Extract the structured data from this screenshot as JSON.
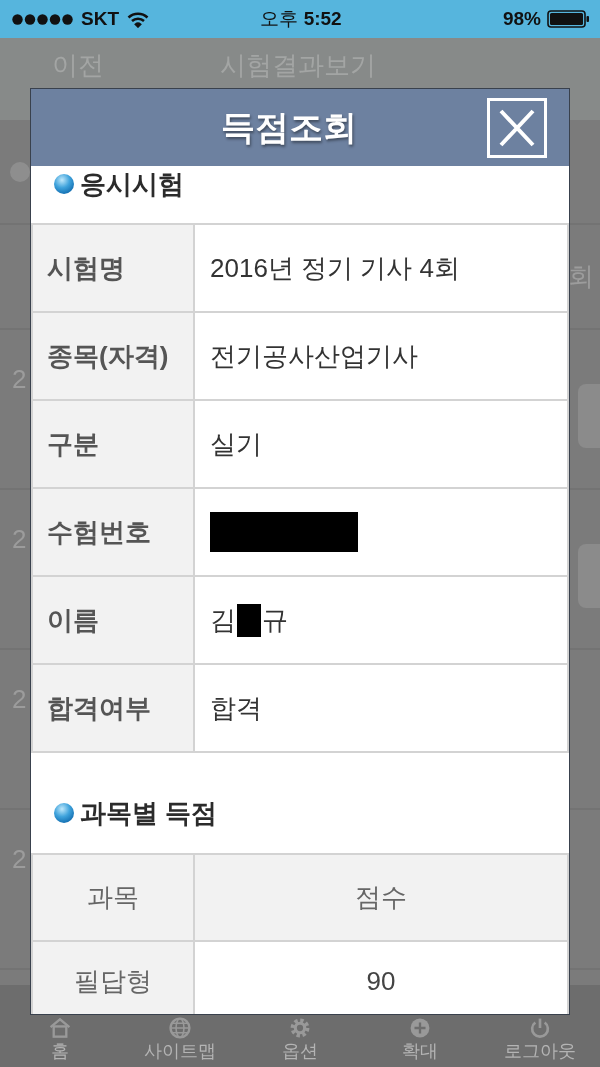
{
  "status_bar": {
    "carrier": "SKT",
    "time": "오후 **5:52**",
    "battery": "98%"
  },
  "background": {
    "back_button": "이전",
    "title": "시험결과보기",
    "column_header": "회",
    "rows": [
      {
        "text": "2",
        "has_button": true
      },
      {
        "text": "2",
        "has_button": true
      },
      {
        "text": "2",
        "has_button": false
      },
      {
        "text": "2",
        "has_button": false
      }
    ]
  },
  "modal": {
    "title": "득점조회",
    "sections": [
      {
        "kind": "details",
        "heading": "응시시험",
        "rows": [
          {
            "label": "시험명",
            "value": "2016년 정기 기사 4회",
            "redacted": false
          },
          {
            "label": "종목(자격)",
            "value": "전기공사산업기사",
            "redacted": false
          },
          {
            "label": "구분",
            "value": "실기",
            "redacted": false
          },
          {
            "label": "수험번호",
            "redacted": true
          },
          {
            "label": "이름",
            "value": "김",
            "value_after": "규",
            "redacted": true
          },
          {
            "label": "합격여부",
            "value": "합격",
            "redacted": false
          }
        ]
      },
      {
        "kind": "scores",
        "heading": "과목별 득점",
        "columns": [
          "과목",
          "점수"
        ],
        "rows": [
          {
            "subject": "필답형",
            "score": "90"
          }
        ]
      }
    ]
  },
  "tab_bar": [
    {
      "kind": "home",
      "label": "홈"
    },
    {
      "kind": "sitemap",
      "label": "사이트맵"
    },
    {
      "kind": "options",
      "label": "옵션"
    },
    {
      "kind": "zoom",
      "label": "확대"
    },
    {
      "kind": "logout",
      "label": "로그아웃"
    }
  ]
}
